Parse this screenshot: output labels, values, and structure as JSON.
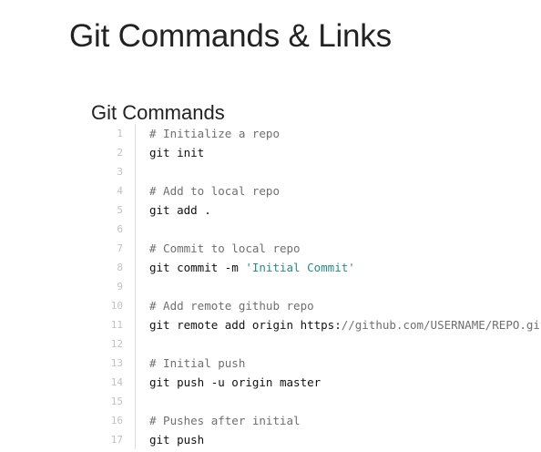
{
  "page": {
    "title": "Git Commands & Links"
  },
  "section": {
    "title": "Git Commands"
  },
  "code": {
    "lines": [
      {
        "num": "1",
        "parts": [
          {
            "text": "# Initialize a repo",
            "kind": "comment"
          }
        ]
      },
      {
        "num": "2",
        "parts": [
          {
            "text": "git init",
            "kind": "plain"
          }
        ]
      },
      {
        "num": "3",
        "parts": []
      },
      {
        "num": "4",
        "parts": [
          {
            "text": "# Add to local repo",
            "kind": "comment"
          }
        ]
      },
      {
        "num": "5",
        "parts": [
          {
            "text": "git add .",
            "kind": "plain"
          }
        ]
      },
      {
        "num": "6",
        "parts": []
      },
      {
        "num": "7",
        "parts": [
          {
            "text": "# Commit to local repo",
            "kind": "comment"
          }
        ]
      },
      {
        "num": "8",
        "parts": [
          {
            "text": "git commit -m ",
            "kind": "plain"
          },
          {
            "text": "'Initial Commit'",
            "kind": "string"
          }
        ]
      },
      {
        "num": "9",
        "parts": []
      },
      {
        "num": "10",
        "parts": [
          {
            "text": "# Add remote github repo",
            "kind": "comment"
          }
        ]
      },
      {
        "num": "11",
        "parts": [
          {
            "text": "git remote add origin https:",
            "kind": "plain"
          },
          {
            "text": "//github.com/USERNAME/REPO.git",
            "kind": "comment"
          }
        ]
      },
      {
        "num": "12",
        "parts": []
      },
      {
        "num": "13",
        "parts": [
          {
            "text": "# Initial push",
            "kind": "comment"
          }
        ]
      },
      {
        "num": "14",
        "parts": [
          {
            "text": "git push -u origin master",
            "kind": "plain"
          }
        ]
      },
      {
        "num": "15",
        "parts": []
      },
      {
        "num": "16",
        "parts": [
          {
            "text": "# Pushes after initial",
            "kind": "comment"
          }
        ]
      },
      {
        "num": "17",
        "parts": [
          {
            "text": "git push",
            "kind": "plain"
          }
        ]
      }
    ]
  },
  "colors": {
    "text": "#222222",
    "comment": "#6f6f6f",
    "string": "#2a8a8a",
    "line_number": "#c2c2c2",
    "gutter_border": "#dddddd"
  }
}
